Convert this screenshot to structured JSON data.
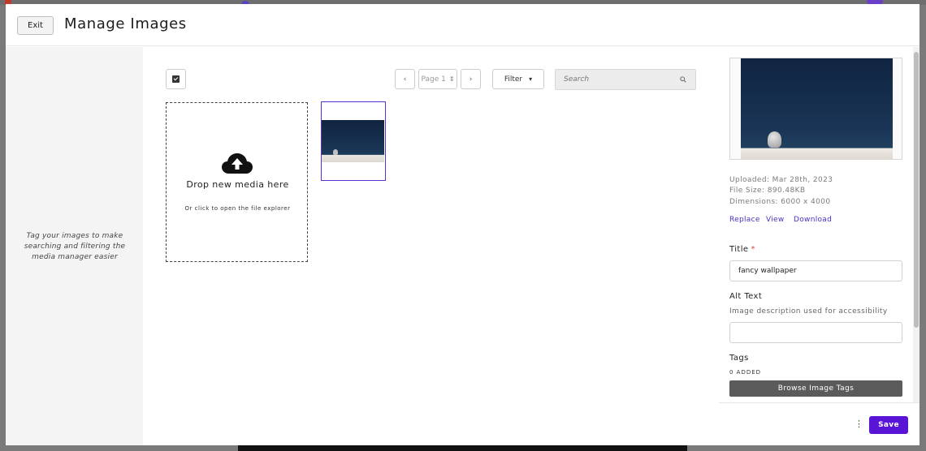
{
  "header": {
    "exit_label": "Exit",
    "title": "Manage Images"
  },
  "sidebar": {
    "hint": "Tag your images to make searching and filtering the media manager easier"
  },
  "toolbar": {
    "prev_icon": "‹",
    "next_icon": "›",
    "page_label": "Page 1",
    "page_arrow": "⇕",
    "filter_label": "Filter",
    "filter_arrow": "▾",
    "search_placeholder": "Search"
  },
  "dropzone": {
    "title": "Drop new media here",
    "subtitle": "Or click to open the file explorer"
  },
  "details": {
    "uploaded": "Uploaded: Mar 28th, 2023",
    "file_size": "File Size: 890.48KB",
    "dimensions": "Dimensions: 6000 x 4000",
    "links": {
      "replace": "Replace",
      "view": "View",
      "download": "Download"
    },
    "title_label": "Title",
    "required_mark": "*",
    "title_value": "fancy wallpaper",
    "alt_label": "Alt Text",
    "alt_help": "Image description used for accessibility",
    "alt_value": "",
    "tags_label": "Tags",
    "tags_added": "0 ADDED",
    "browse_label": "Browse Image Tags"
  },
  "footer": {
    "more_icon": "⋮",
    "save_label": "Save"
  },
  "colors": {
    "accent": "#5a14d6",
    "link": "#4a2ec4",
    "selection": "#5d2fd1"
  }
}
